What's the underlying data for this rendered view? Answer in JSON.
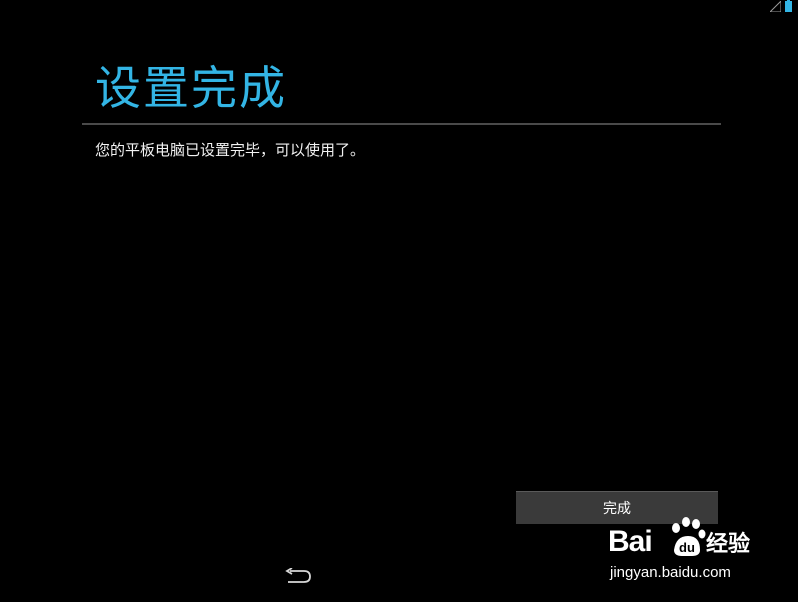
{
  "status_bar": {
    "icons": [
      "signal-icon",
      "battery-icon"
    ]
  },
  "setup": {
    "title": "设置完成",
    "message": "您的平板电脑已设置完毕，可以使用了。",
    "done_label": "完成"
  },
  "nav": {
    "icons": [
      "back-icon"
    ]
  },
  "watermark": {
    "brand_left": "Bai",
    "brand_right": "经验",
    "url": "jingyan.baidu.com"
  },
  "colors": {
    "accent": "#33b5e5",
    "background": "#000000",
    "button": "#3a3a3a",
    "divider": "#4a4a4a"
  }
}
